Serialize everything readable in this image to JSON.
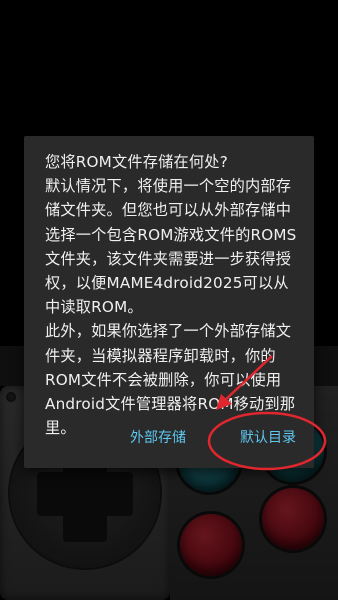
{
  "dialog": {
    "message": "您将ROM文件存储在何处?\n默认情况下，将使用一个空的内部存储文件夹。但您也可以从外部存储中选择一个包含ROM游戏文件的ROMS文件夹，该文件夹需要进一步获得授权，以便MAME4droid2025可以从中读取ROM。\n此外，如果你选择了一个外部存储文件夹，当模拟器程序卸载时，你的ROM文件不会被删除，你可以使用Android文件管理器将ROM移动到那里。",
    "buttons": {
      "external_storage": "外部存储",
      "default_directory": "默认目录"
    }
  },
  "colors": {
    "dialog_bg": "#2a2a2a",
    "button_text": "#5fc8f0",
    "annotation": "#e0262e"
  }
}
